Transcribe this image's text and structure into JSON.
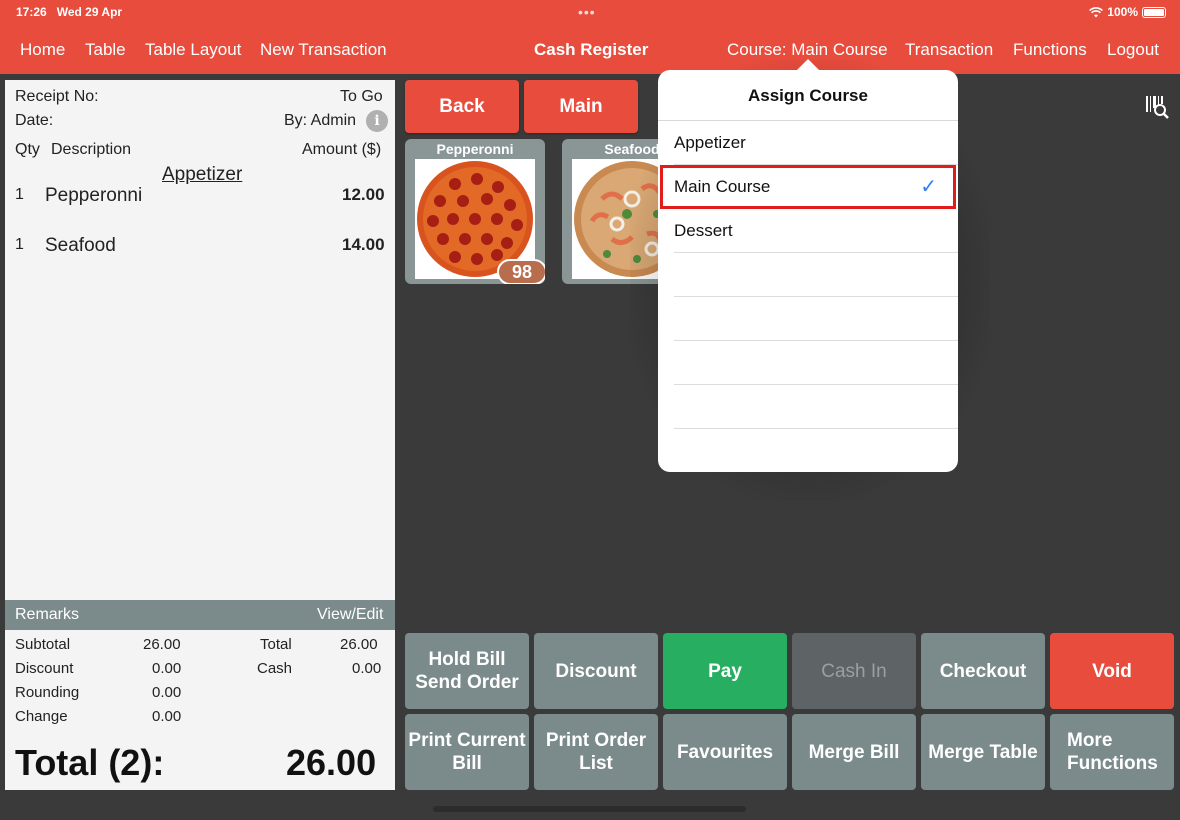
{
  "status": {
    "time": "17:26",
    "date": "Wed 29 Apr",
    "battery": "100%"
  },
  "nav": {
    "home": "Home",
    "table": "Table",
    "table_layout": "Table Layout",
    "new_transaction": "New Transaction",
    "title": "Cash Register",
    "course": "Course: Main Course",
    "transaction": "Transaction",
    "functions": "Functions",
    "logout": "Logout"
  },
  "receipt": {
    "receipt_no_label": "Receipt No:",
    "order_type": "To Go",
    "date_label": "Date:",
    "by": "By: Admin",
    "col_qty": "Qty",
    "col_desc": "Description",
    "col_amount": "Amount ($)",
    "course_heading": "Appetizer",
    "items": [
      {
        "qty": "1",
        "name": "Pepperonni",
        "amount": "12.00"
      },
      {
        "qty": "1",
        "name": "Seafood",
        "amount": "14.00"
      }
    ],
    "remarks_label": "Remarks",
    "view_edit": "View/Edit",
    "subtotal_label": "Subtotal",
    "subtotal": "26.00",
    "discount_label": "Discount",
    "discount": "0.00",
    "rounding_label": "Rounding",
    "rounding": "0.00",
    "change_label": "Change",
    "change": "0.00",
    "total_label": "Total",
    "total": "26.00",
    "cash_label": "Cash",
    "cash": "0.00",
    "grand_label": "Total (2):",
    "grand_value": "26.00"
  },
  "categories": {
    "back": "Back",
    "main": "Main"
  },
  "products": [
    {
      "name": "Pepperonni",
      "stock": "98"
    },
    {
      "name": "Seafood"
    }
  ],
  "actions": {
    "hold_bill": "Hold Bill",
    "send_order": "Send Order",
    "discount": "Discount",
    "pay": "Pay",
    "cash_in": "Cash In",
    "checkout": "Checkout",
    "void": "Void",
    "print_current": "Print Current",
    "bill": "Bill",
    "print_order": "Print Order",
    "list": "List",
    "favourites": "Favourites",
    "merge_bill": "Merge Bill",
    "merge_table": "Merge Table",
    "more": "More",
    "more_functions": "Functions"
  },
  "popover": {
    "title": "Assign Course",
    "options": [
      "Appetizer",
      "Main Course",
      "Dessert"
    ],
    "selected": "Main Course",
    "checkmark": "✓"
  },
  "colors": {
    "brand": "#e84c3d",
    "pay": "#27ae60",
    "gray_button": "#7b8a8b",
    "highlight": "#e21b1b",
    "check": "#2f7cf6"
  }
}
